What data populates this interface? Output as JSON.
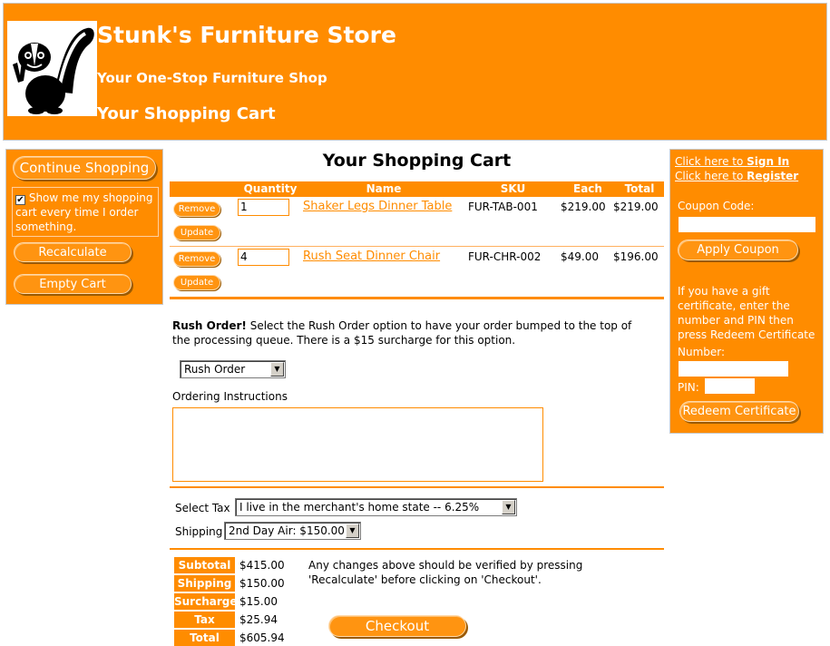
{
  "header": {
    "title": "Stunk's Furniture Store",
    "tagline": "Your One-Stop Furniture Shop",
    "subtitle": "Your Shopping Cart"
  },
  "left": {
    "continue_label": "Continue Shopping",
    "show_me_text": "Show me my shopping cart every time I order something.",
    "show_me_checked": true,
    "recalculate_label": "Recalculate",
    "empty_cart_label": "Empty Cart"
  },
  "cart": {
    "title": "Your Shopping Cart",
    "columns": [
      "Quantity",
      "Name",
      "SKU",
      "Each",
      "Total"
    ],
    "remove_label": "Remove",
    "update_label": "Update",
    "items": [
      {
        "qty": "1",
        "name": "Shaker Legs Dinner Table",
        "sku": "FUR-TAB-001",
        "each": "$219.00",
        "total": "$219.00"
      },
      {
        "qty": "4",
        "name": "Rush Seat Dinner Chair",
        "sku": "FUR-CHR-002",
        "each": "$49.00",
        "total": "$196.00"
      }
    ]
  },
  "rush": {
    "bold": "Rush Order!",
    "text": " Select the Rush Order option to have your order bumped to the top of the processing queue. There is a $15 surcharge for this option.",
    "select_value": "Rush Order"
  },
  "instructions_label": "Ordering Instructions",
  "tax": {
    "label": "Select Tax",
    "value": "I live in the merchant's home state -- 6.25%"
  },
  "shipping": {
    "label": "Shipping",
    "value": "2nd Day Air: $150.00"
  },
  "summary": {
    "rows": [
      {
        "label": "Subtotal",
        "value": "$415.00"
      },
      {
        "label": "Shipping",
        "value": "$150.00"
      },
      {
        "label": "Surcharge",
        "value": "$15.00"
      },
      {
        "label": "Tax",
        "value": "$25.94"
      },
      {
        "label": "Total",
        "value": "$605.94"
      }
    ],
    "note": "Any changes above should be verified by pressing 'Recalculate' before clicking on 'Checkout'.",
    "checkout_label": "Checkout"
  },
  "right": {
    "signin_prefix": "Click here to ",
    "signin_link": "Sign In",
    "register_prefix": "Click here to ",
    "register_link": "Register",
    "coupon_label": "Coupon Code:",
    "apply_coupon_label": "Apply Coupon",
    "gift_text": "If you have a gift certificate, enter the number and PIN then press Redeem Certificate",
    "number_label": "Number:",
    "pin_label": "PIN:",
    "redeem_label": "Redeem Certificate"
  },
  "colors": {
    "accent": "#ff8c00",
    "text": "#000000"
  }
}
